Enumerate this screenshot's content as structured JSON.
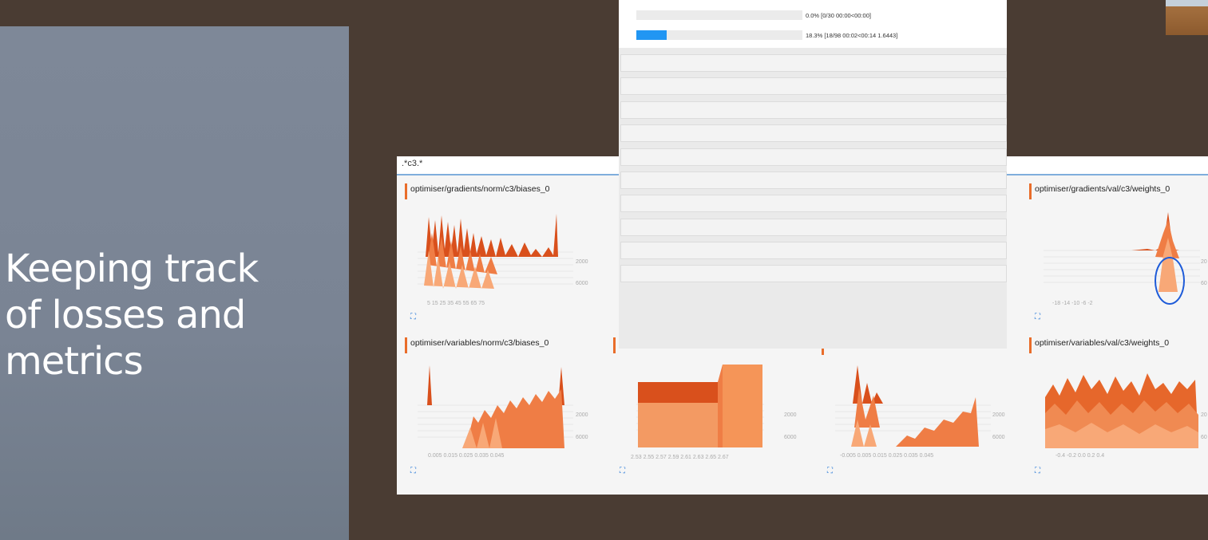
{
  "slide": {
    "title_lines": [
      "Keeping track",
      "of losses and",
      "metrics"
    ]
  },
  "tensorboard": {
    "filter": ".*c3.*",
    "cards": [
      {
        "title": "optimiser/gradients/norm/c3/biases_0",
        "x_ticks": "5    15    25    35    45    55    65    75",
        "steps": [
          "2000",
          "6000"
        ]
      },
      {
        "title": "optimiser/gradients/val/c3/weights_0",
        "x_ticks": "-18    -14    -10    -6    -2",
        "steps": [
          "20",
          "60"
        ]
      },
      {
        "title": "optimiser/variables/norm/c3/biases_0",
        "x_ticks": "0.005    0.015    0.025    0.035    0.045",
        "steps": [
          "2000",
          "6000"
        ]
      },
      {
        "title": "",
        "x_ticks": "2.53 2.55 2.57 2.59 2.61 2.63 2.65 2.67",
        "steps": [
          "2000",
          "6000"
        ]
      },
      {
        "title": "",
        "x_ticks": "-0.005  0.005  0.015  0.025  0.035  0.045",
        "steps": [
          "2000",
          "6000"
        ]
      },
      {
        "title": "optimiser/variables/val/c3/weights_0",
        "x_ticks": "-0.4    -0.2    0.0    0.2    0.4",
        "steps": [
          "20",
          "60"
        ]
      }
    ],
    "colors": {
      "accent": "#e96d2a",
      "highlight_circle": "#1e5bd8"
    }
  },
  "progress": {
    "bars": [
      {
        "text": "0.0% [0/30 00:00<00:00]",
        "fraction": 0.0
      },
      {
        "text": "18.3% [18/98 00:02<00:14 1.6443]",
        "fraction": 0.183
      }
    ],
    "color": "#2196f3"
  }
}
